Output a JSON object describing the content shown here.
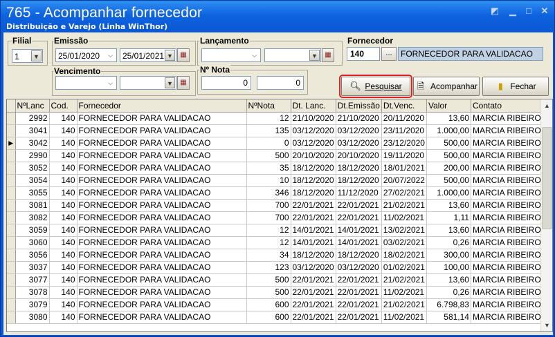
{
  "window": {
    "title": "765 - Acompanhar fornecedor",
    "subtitle": "Distribuição e Varejo (Linha WinThor)",
    "controls": [
      "restore-icon",
      "minimize-icon",
      "maximize-icon",
      "close-icon"
    ]
  },
  "filters": {
    "filial": {
      "label": "Filial",
      "value": "1"
    },
    "emissao": {
      "label": "Emissão",
      "from": "25/01/2020",
      "to": "25/01/2021"
    },
    "lancamento": {
      "label": "Lançamento",
      "from": "",
      "to": ""
    },
    "vencimento": {
      "label": "Vencimento",
      "from": "",
      "to": ""
    },
    "nota": {
      "label": "Nº Nota",
      "from": "0",
      "to": "0"
    },
    "fornecedor": {
      "label": "Fornecedor",
      "code": "140",
      "browse_label": "...",
      "name": "FORNECEDOR PARA VALIDACAO"
    }
  },
  "buttons": {
    "pesquisar": "Pesquisar",
    "acompanhar": "Acompanhar",
    "fechar": "Fechar"
  },
  "grid": {
    "columns": [
      "NºLanc",
      "Cod.",
      "Fornecedor",
      "NºNota",
      "Dt. Lanc.",
      "Dt.Emissão",
      "Dt.Venc.",
      "Valor",
      "Contato"
    ],
    "current_row_marker": "▶",
    "rows": [
      [
        "2992",
        "140",
        "FORNECEDOR PARA VALIDACAO",
        "12",
        "21/10/2020",
        "21/10/2020",
        "20/11/2020",
        "13,60",
        "MARCIA RIBEIRO"
      ],
      [
        "3041",
        "140",
        "FORNECEDOR PARA VALIDACAO",
        "135",
        "03/12/2020",
        "03/12/2020",
        "23/11/2020",
        "1.000,00",
        "MARCIA RIBEIRO"
      ],
      [
        "3042",
        "140",
        "FORNECEDOR PARA VALIDACAO",
        "0",
        "03/12/2020",
        "03/12/2020",
        "23/12/2020",
        "500,00",
        "MARCIA RIBEIRO"
      ],
      [
        "2990",
        "140",
        "FORNECEDOR PARA VALIDACAO",
        "500",
        "20/10/2020",
        "20/10/2020",
        "19/11/2020",
        "500,00",
        "MARCIA RIBEIRO"
      ],
      [
        "3052",
        "140",
        "FORNECEDOR PARA VALIDACAO",
        "35",
        "18/12/2020",
        "18/12/2020",
        "18/01/2021",
        "200,00",
        "MARCIA RIBEIRO"
      ],
      [
        "3054",
        "140",
        "FORNECEDOR PARA VALIDACAO",
        "10",
        "18/12/2020",
        "18/12/2020",
        "20/07/2022",
        "500,00",
        "MARCIA RIBEIRO"
      ],
      [
        "3055",
        "140",
        "FORNECEDOR PARA VALIDACAO",
        "346",
        "18/12/2020",
        "11/12/2020",
        "27/02/2021",
        "1.000,00",
        "MARCIA RIBEIRO"
      ],
      [
        "3081",
        "140",
        "FORNECEDOR PARA VALIDACAO",
        "700",
        "22/01/2021",
        "22/01/2021",
        "21/02/2021",
        "13,60",
        "MARCIA RIBEIRO"
      ],
      [
        "3082",
        "140",
        "FORNECEDOR PARA VALIDACAO",
        "700",
        "22/01/2021",
        "22/01/2021",
        "11/02/2021",
        "1,11",
        "MARCIA RIBEIRO"
      ],
      [
        "3059",
        "140",
        "FORNECEDOR PARA VALIDACAO",
        "12",
        "14/01/2021",
        "14/01/2021",
        "13/02/2021",
        "13,60",
        "MARCIA RIBEIRO"
      ],
      [
        "3060",
        "140",
        "FORNECEDOR PARA VALIDACAO",
        "12",
        "14/01/2021",
        "14/01/2021",
        "03/02/2021",
        "0,26",
        "MARCIA RIBEIRO"
      ],
      [
        "3056",
        "140",
        "FORNECEDOR PARA VALIDACAO",
        "34",
        "18/12/2020",
        "18/12/2020",
        "18/02/2021",
        "300,00",
        "MARCIA RIBEIRO"
      ],
      [
        "3037",
        "140",
        "FORNECEDOR PARA VALIDACAO",
        "123",
        "03/12/2020",
        "03/12/2020",
        "01/02/2021",
        "100,00",
        "MARCIA RIBEIRO"
      ],
      [
        "3077",
        "140",
        "FORNECEDOR PARA VALIDACAO",
        "500",
        "22/01/2021",
        "22/01/2021",
        "21/02/2021",
        "13,60",
        "MARCIA RIBEIRO"
      ],
      [
        "3078",
        "140",
        "FORNECEDOR PARA VALIDACAO",
        "500",
        "22/01/2021",
        "22/01/2021",
        "11/02/2021",
        "0,26",
        "MARCIA RIBEIRO"
      ],
      [
        "3079",
        "140",
        "FORNECEDOR PARA VALIDACAO",
        "600",
        "22/01/2021",
        "22/01/2021",
        "21/02/2021",
        "6.798,83",
        "MARCIA RIBEIRO"
      ],
      [
        "3080",
        "140",
        "FORNECEDOR PARA VALIDACAO",
        "600",
        "22/01/2021",
        "22/01/2021",
        "11/02/2021",
        "581,14",
        "MARCIA RIBEIRO"
      ]
    ],
    "current_row_index": 2
  },
  "colors": {
    "titlebar": "#0a57d2",
    "client_bg": "#ece9d8",
    "focus_outline": "#e0231f",
    "readonly_field": "#bfd1e2"
  }
}
